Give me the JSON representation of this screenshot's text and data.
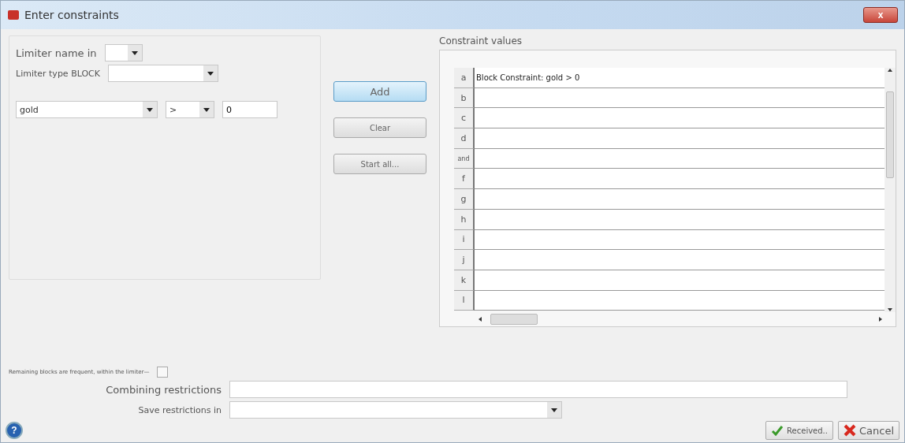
{
  "window": {
    "title": "Enter constraints",
    "close": "x"
  },
  "limiter_name": {
    "label": "Limiter name in"
  },
  "limiter_type": {
    "label": "Limiter type BLOCK"
  },
  "condition": {
    "field": "gold",
    "operator": ">",
    "value": "0"
  },
  "buttons": [
    {
      "label": "Add",
      "kind": "default"
    },
    {
      "label": "Clear",
      "kind": "normal"
    },
    {
      "label": "Start all...",
      "kind": "normal"
    }
  ],
  "constraint_values": {
    "title": "Constraint values",
    "rows": [
      {
        "label": "a",
        "value": "Block Constraint: gold > 0"
      },
      {
        "label": "b"
      },
      {
        "label": "c"
      },
      {
        "label": "d"
      },
      {
        "label": "and"
      },
      {
        "label": "f"
      },
      {
        "label": "g"
      },
      {
        "label": "h"
      },
      {
        "label": "i"
      },
      {
        "label": "j"
      },
      {
        "label": "k"
      },
      {
        "label": "l"
      }
    ]
  },
  "remaining_blocks": {
    "label": "Remaining blocks are frequent, within the limiter—",
    "checked": false
  },
  "combining_restrictions": {
    "label": "Combining restrictions"
  },
  "save_restrictions": {
    "label": "Save restrictions in"
  },
  "footer": {
    "help": "?",
    "ok": "Received..",
    "cancel": "Cancel"
  }
}
